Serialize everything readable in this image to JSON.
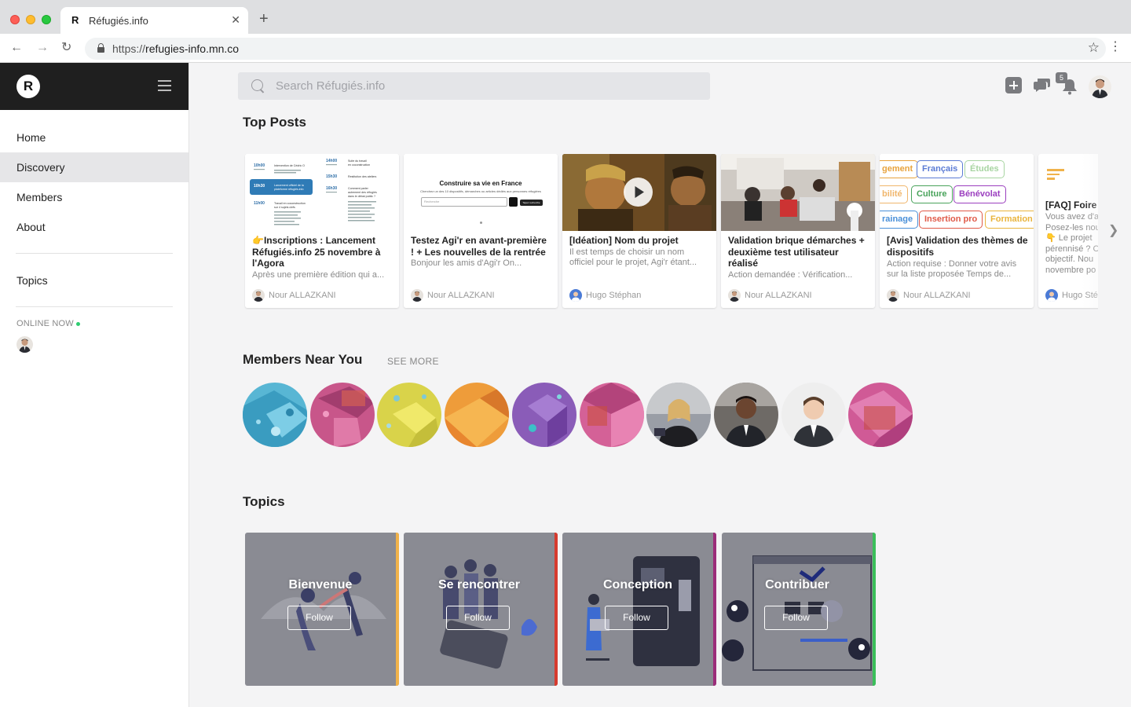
{
  "browser": {
    "tab_title": "Réfugiés.info",
    "tab_favicon": "R",
    "url_prefix": "https://",
    "url_host": "refugies-info.mn.co"
  },
  "sidebar": {
    "logo_letter": "R",
    "items": [
      {
        "label": "Home",
        "active": false
      },
      {
        "label": "Discovery",
        "active": true
      },
      {
        "label": "Members",
        "active": false
      },
      {
        "label": "About",
        "active": false
      }
    ],
    "topics_label": "Topics",
    "online_now_label": "ONLINE NOW"
  },
  "header": {
    "search_placeholder": "Search Réfugiés.info",
    "notification_count": "5"
  },
  "top_posts": {
    "title": "Top Posts",
    "posts": [
      {
        "title": "👉Inscriptions : Lancement Réfugiés.info 25 novembre à l'Agora",
        "excerpt": "Après une première édition qui a...",
        "author": "Nour ALLAZKANI"
      },
      {
        "title": "Testez Agi'r en avant-première ! + Les nouvelles de la rentrée",
        "excerpt": "Bonjour les amis d'Agi'r On...",
        "author": "Nour ALLAZKANI"
      },
      {
        "title": "[Idéation] Nom du projet",
        "excerpt_lines": [
          "Il est temps de choisir un nom",
          "officiel pour le projet, Agi'r étant..."
        ],
        "author": "Hugo Stéphan"
      },
      {
        "title": "Validation brique démarches + deuxième test utilisateur réalisé",
        "excerpt": "Action demandée : Vérification...",
        "author": "Nour ALLAZKANI"
      },
      {
        "title": "[Avis] Validation des thèmes de dispositifs",
        "excerpt_lines": [
          "Action requise : Donner votre avis",
          "sur la liste proposée Temps de..."
        ],
        "author": "Nour ALLAZKANI"
      },
      {
        "title": "[FAQ] Foire aux qu",
        "excerpt_lines": [
          "Vous avez d'a",
          "Posez-les nou",
          "👇 Le projet",
          "pérennisé ? C",
          "objectif. Nou",
          "novembre po"
        ],
        "author": "Hugo Stép"
      }
    ],
    "thumb2_heading": "Construire sa vie en France",
    "thumb2_sub": "Cherchez un des 10 dispositifs, démarches ou articles dédiés aux personnes réfugiées",
    "thumb2_input": "Recherche",
    "thumb2_btn": "Tapez recherche",
    "tags": [
      {
        "label": "gement",
        "color": "#e8a33d"
      },
      {
        "label": "Français",
        "color": "#5b7bd5"
      },
      {
        "label": "Études",
        "color": "#a8d5a2"
      },
      {
        "label": "bilité",
        "color": "#f0b66c"
      },
      {
        "label": "Culture",
        "color": "#49a35b"
      },
      {
        "label": "Bénévolat",
        "color": "#9b3fbf"
      },
      {
        "label": "rainage",
        "color": "#4a90d9"
      },
      {
        "label": "Insertion pro",
        "color": "#e05a48"
      },
      {
        "label": "Formation",
        "color": "#e9b43d"
      }
    ],
    "thumb1_schedule": [
      {
        "time": "10h00",
        "text": "Intervention de Cédric O"
      },
      {
        "time": "10h30",
        "text": "Lancement officiel de la plateforme réfugiés.info"
      },
      {
        "time": "11h00",
        "text": "Travail en coconstruction sur 4 sujets clefs"
      },
      {
        "time": "14h00",
        "text": "Suite du travail en coconstruction"
      },
      {
        "time": "15h30",
        "text": "Restitution des ateliers"
      },
      {
        "time": "16h30",
        "text": "Comment parler autrement des réfugiés dans le débat public ?"
      }
    ]
  },
  "members": {
    "title": "Members Near You",
    "see_more": "SEE MORE"
  },
  "topics": {
    "title": "Topics",
    "cards": [
      {
        "name": "Bienvenue",
        "follow": "Follow",
        "accent": "#f0b24a"
      },
      {
        "name": "Se rencontrer",
        "follow": "Follow",
        "accent": "#d63b2f"
      },
      {
        "name": "Conception",
        "follow": "Follow",
        "accent": "#9b2d7a"
      },
      {
        "name": "Contribuer",
        "follow": "Follow",
        "accent": "#3bbf5a"
      }
    ]
  },
  "colors": {
    "sidebar_header": "#1f1f1f",
    "page_bg": "#f4f4f5",
    "online_dot": "#2ecc71"
  },
  "icons": [
    "search-icon",
    "plus-icon",
    "chat-icon",
    "bell-icon",
    "hamburger-icon",
    "lock-icon",
    "star-icon",
    "play-icon",
    "chevron-right-icon"
  ]
}
